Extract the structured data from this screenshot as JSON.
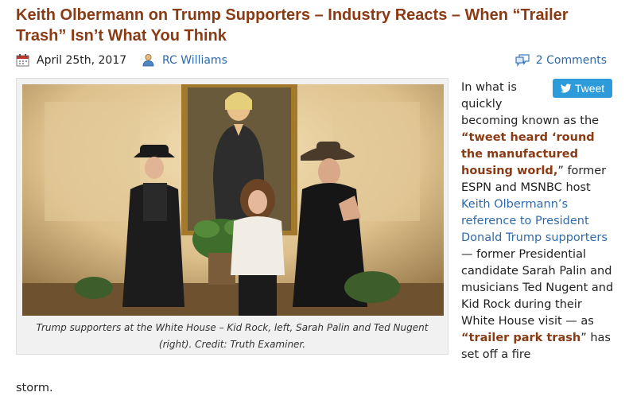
{
  "article": {
    "title": "Keith Olbermann on Trump Supporters – Industry Reacts – When “Trailer Trash” Isn’t What You Think",
    "date": "April 25th, 2017",
    "author": "RC Williams",
    "comments": "2 Comments",
    "tweet_label": "Tweet",
    "caption": "Trump supporters at the White House – Kid Rock, left, Sarah Palin and Ted Nugent (right). Credit: Truth Examiner.",
    "body": {
      "p1": "In what is quickly becoming known as the ",
      "strong1": "“tweet heard ‘round the manufactured housing world,",
      "p2": "” former ESPN and MSNBC host ",
      "link1": "Keith Olbermann’s reference to President Donald Trump supporters",
      "p3": " — former Presidential candidate Sarah Palin and musicians Ted Nugent and Kid Rock during their White House visit — as ",
      "strong2": "“trailer park trash",
      "p4": "” has set off a fire",
      "tail": "storm."
    }
  },
  "colors": {
    "title": "#8a3b14",
    "link": "#2f6aa8",
    "tweet_bg": "#2d9bd9"
  },
  "icons": {
    "date": "calendar-icon",
    "author": "person-icon",
    "comments": "comment-bubble-icon",
    "tweet": "twitter-bird-icon"
  }
}
